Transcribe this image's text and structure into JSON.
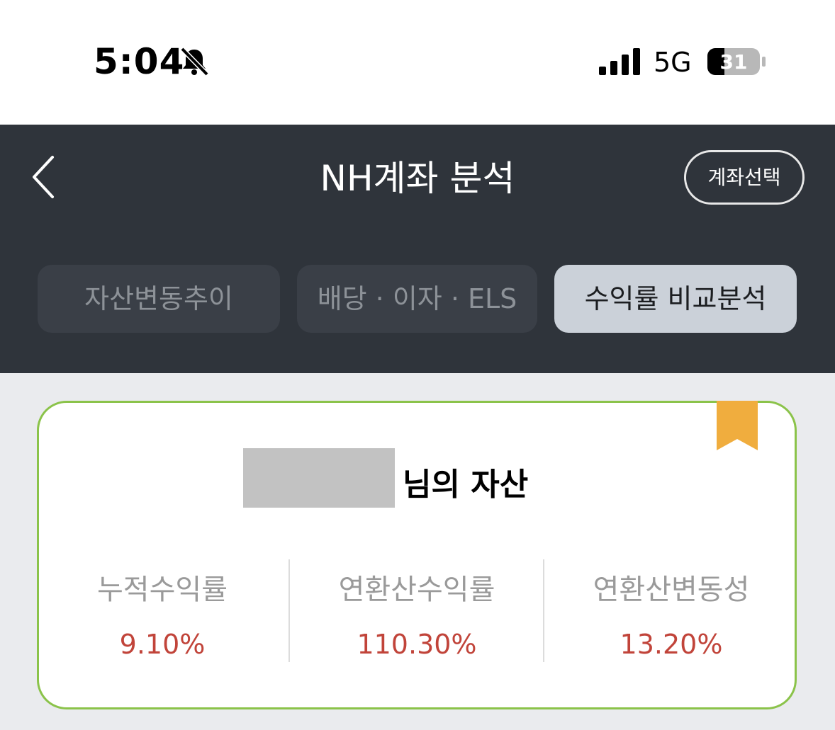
{
  "status_bar": {
    "time": "5:04",
    "network": "5G",
    "battery_level": "31",
    "icons": [
      "bell-slash-icon",
      "signal-icon",
      "battery-icon"
    ]
  },
  "header": {
    "back_icon": "chevron-left-icon",
    "title": "NH계좌 분석",
    "account_select_label": "계좌선택"
  },
  "tabs": [
    {
      "label": "자산변동추이",
      "active": false
    },
    {
      "label": "배당 · 이자 · ELS",
      "active": false
    },
    {
      "label": "수익률 비교분석",
      "active": true
    }
  ],
  "summary_card": {
    "owner_suffix": "님의 자산",
    "metrics": [
      {
        "label": "누적수익률",
        "value": "9.10%"
      },
      {
        "label": "연환산수익률",
        "value": "110.30%"
      },
      {
        "label": "연환산변동성",
        "value": "13.20%"
      }
    ]
  },
  "colors": {
    "header_bg": "#2f343b",
    "active_tab_bg": "#cbd1d9",
    "card_border": "#8bc34a",
    "bookmark": "#f0ad3e",
    "value_red": "#c1443a"
  }
}
